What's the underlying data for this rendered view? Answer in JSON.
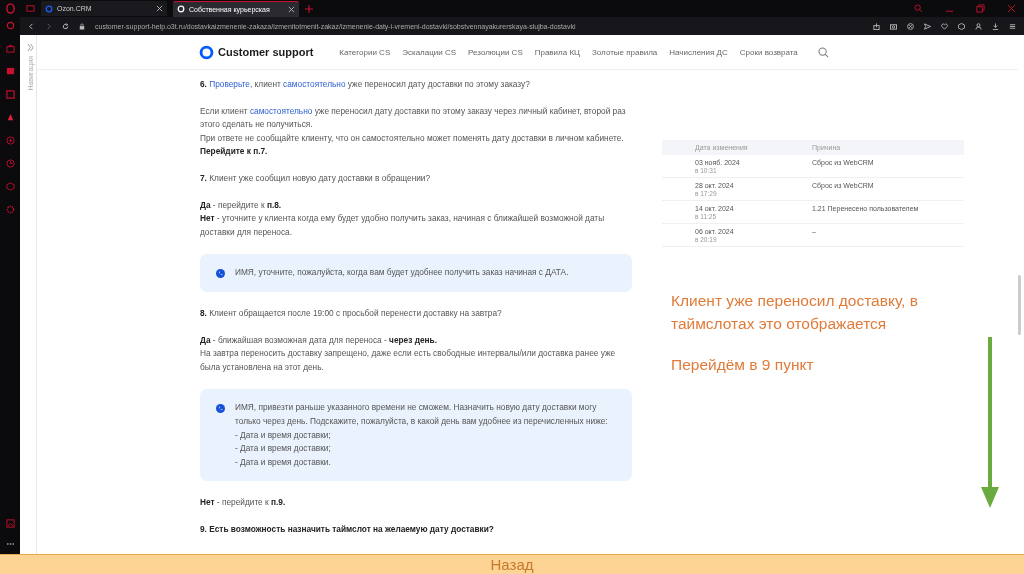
{
  "browser": {
    "tabs": [
      {
        "title": "Ozon.CRM",
        "selected": false
      },
      {
        "title": "Собственная курьерская",
        "selected": true
      }
    ],
    "url": "customer-support-help.o3t.ru/dostavkaizmenenie-zakaza/izmenitotmenit-zakaz/izmenenie-daty-i-vremeni-dostavki/sobstvennayakurerskaya-slujba-dostavki"
  },
  "side_panel": {
    "label": "Навигация"
  },
  "header": {
    "brand": "Customer support",
    "nav": [
      "Категории CS",
      "Эскалации CS",
      "Резолюции CS",
      "Правила КЦ",
      "Золотые правила",
      "Начисления ДС",
      "Сроки возврата"
    ]
  },
  "article": [
    {
      "kind": "para",
      "lines": [
        [
          "**6.** ",
          {
            "link": "Проверьте"
          },
          ", клиент ",
          {
            "link": "самостоятельно"
          },
          " уже переносил дату доставки по этому заказу?"
        ]
      ]
    },
    {
      "kind": "para",
      "lines": [
        [
          "Если клиент ",
          {
            "link": "самостоятельно"
          },
          " уже переносил дату доставки по этому заказу через личный кабинет, второй раз этого сделать не получиться."
        ],
        [
          "При ответе не сообщайте клиенту, что он самостоятельно может поменять дату доставки в личном кабинете."
        ],
        [
          "**Перейдите к п.7.**"
        ]
      ]
    },
    {
      "kind": "para",
      "lines": [
        [
          "**7.** Клиент уже сообщил новую дату доставки в обращении?"
        ]
      ]
    },
    {
      "kind": "para",
      "lines": [
        [
          "**Да** - перейдите к **п.8.**"
        ],
        [
          "**Нет** - уточните у клиента когда ему будет удобно получить заказ, начиная с ближайшей возможной даты доставки для переноса."
        ]
      ]
    },
    {
      "kind": "callout",
      "lines": [
        "ИМЯ, уточните, пожалуйста, когда вам будет удобнее получить заказ начиная с ДАТА."
      ]
    },
    {
      "kind": "para",
      "lines": [
        [
          "**8.** Клиент обращается после 19:00 с просьбой перенести доставку на завтра?"
        ]
      ]
    },
    {
      "kind": "para",
      "lines": [
        [
          "**Да** - ближайшая возможная дата для переноса - **через день.**"
        ],
        [
          "На завтра переносить доставку запрещено, даже если есть свободные интервалы/или доставка ранее уже была установлена на этот день."
        ]
      ]
    },
    {
      "kind": "callout",
      "lines": [
        "ИМЯ, привезти раньше указанного времени не сможем. Назначить новую дату доставки могу только через день. Подскажите, пожалуйста, в какой день вам удобнее из перечисленных ниже:",
        "- Дата и время доставки;",
        "- Дата и время доставки;",
        "- Дата и время доставки."
      ]
    },
    {
      "kind": "para",
      "lines": [
        [
          "**Нет** - перейдите к **п.9.**"
        ]
      ]
    },
    {
      "kind": "para",
      "lines": [
        [
          "**9. Есть возможность назначить таймслот на желаемую дату доставки?**"
        ]
      ]
    }
  ],
  "history_table": {
    "columns": [
      "Дата изменения",
      "Причина"
    ],
    "rows": [
      {
        "date": "03 нояб. 2024",
        "time": "в 10:31",
        "reason": "Сброс из WebCRM"
      },
      {
        "date": "28 окт. 2024",
        "time": "в 17:29",
        "reason": "Сброс из WebCRM"
      },
      {
        "date": "14 окт. 2024",
        "time": "в 11:25",
        "reason": "1.21 Перенесено пользователем"
      },
      {
        "date": "06 окт. 2024",
        "time": "в 20:19",
        "reason": "–"
      }
    ]
  },
  "annotation": [
    "Клиент уже переносил доставку, в таймслотах это отображается",
    "Перейдём в 9 пункт"
  ],
  "back_bar": {
    "label": "Назад"
  }
}
